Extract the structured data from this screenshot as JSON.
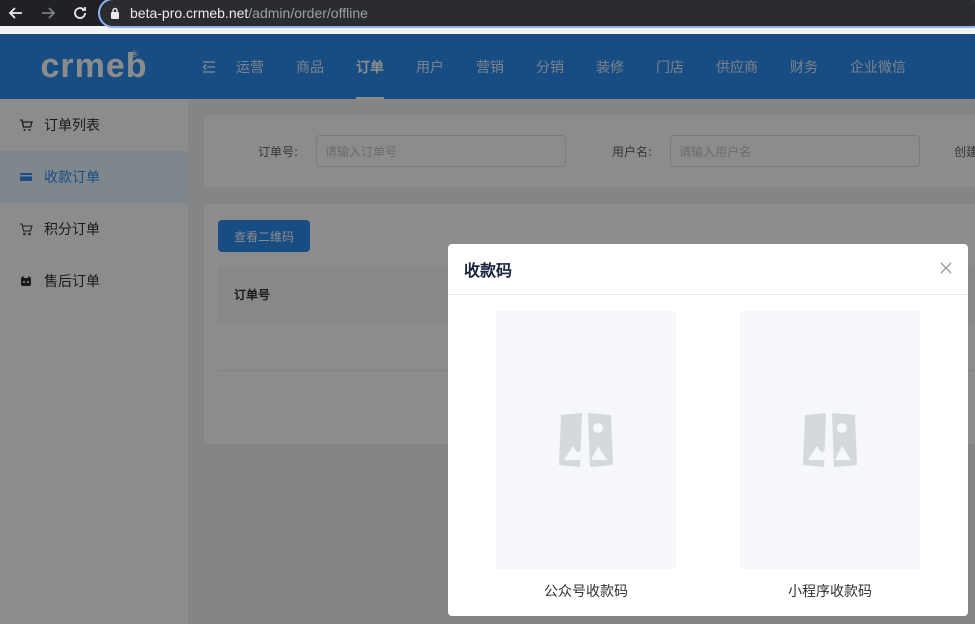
{
  "browser": {
    "url_host": "beta-pro.crmeb.net",
    "url_path": "/admin/order/offline"
  },
  "header": {
    "logo": "crmeb",
    "logo_reg": "®",
    "nav": [
      {
        "label": "运营"
      },
      {
        "label": "商品"
      },
      {
        "label": "订单"
      },
      {
        "label": "用户"
      },
      {
        "label": "营销"
      },
      {
        "label": "分销"
      },
      {
        "label": "装修"
      },
      {
        "label": "门店"
      },
      {
        "label": "供应商"
      },
      {
        "label": "财务"
      },
      {
        "label": "企业微信"
      }
    ],
    "active_nav": "订单"
  },
  "sidebar": {
    "items": [
      {
        "label": "订单列表",
        "icon": "cart-icon"
      },
      {
        "label": "收款订单",
        "icon": "card-icon"
      },
      {
        "label": "积分订单",
        "icon": "cart-outline-icon"
      },
      {
        "label": "售后订单",
        "icon": "service-icon"
      }
    ],
    "active_index": 1
  },
  "filters": {
    "order_no_label": "订单号:",
    "order_no_placeholder": "请输入订单号",
    "username_label": "用户名:",
    "username_placeholder": "请输入用户名",
    "created_label": "创建"
  },
  "content": {
    "qr_button": "查看二维码",
    "table_header_order_no": "订单号"
  },
  "modal": {
    "title": "收款码",
    "left_caption": "公众号收款码",
    "right_caption": "小程序收款码"
  },
  "colors": {
    "primary": "#2d8cf0",
    "sidebar_active_bg": "#e8f4ff"
  }
}
